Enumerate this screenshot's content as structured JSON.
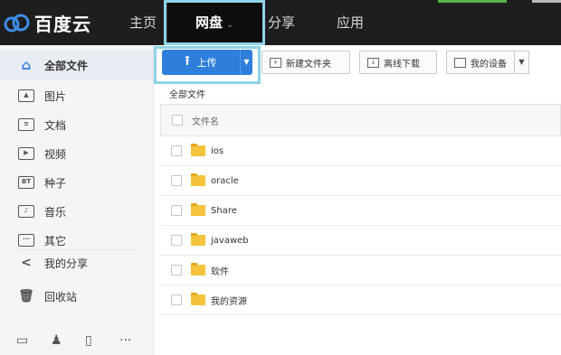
{
  "header": {
    "logo_text": "百度云",
    "nav": [
      {
        "label": "主页"
      },
      {
        "label": "网盘",
        "chevron": "⌄"
      },
      {
        "label": "分享"
      },
      {
        "label": "应用"
      }
    ]
  },
  "sidebar": {
    "items": [
      {
        "label": "全部文件",
        "icon": "home-icon",
        "active": true
      },
      {
        "label": "图片",
        "icon": "image-icon"
      },
      {
        "label": "文档",
        "icon": "document-icon"
      },
      {
        "label": "视频",
        "icon": "video-icon"
      },
      {
        "label": "种子",
        "icon": "bt-icon",
        "icon_text": "BT"
      },
      {
        "label": "音乐",
        "icon": "music-icon"
      },
      {
        "label": "其它",
        "icon": "other-icon"
      },
      {
        "label": "我的分享",
        "icon": "share-icon"
      },
      {
        "label": "回收站",
        "icon": "trash-icon"
      }
    ],
    "devices": [
      "desktop-icon",
      "android-icon",
      "tablet-icon",
      "more-icon"
    ]
  },
  "toolbar": {
    "upload_label": "上传",
    "new_folder_label": "新建文件夹",
    "offline_download_label": "离线下载",
    "my_devices_label": "我的设备"
  },
  "breadcrumb": "全部文件",
  "file_list": {
    "header_label": "文件名",
    "files": [
      "ios",
      "oracle",
      "Share",
      "javaweb",
      "软件",
      "我的资源"
    ]
  },
  "colors": {
    "topbar": "#1e1e1e",
    "accent_blue": "#2e7fdb",
    "highlight": "#8fd3e8",
    "folder": "#f5c33b"
  }
}
